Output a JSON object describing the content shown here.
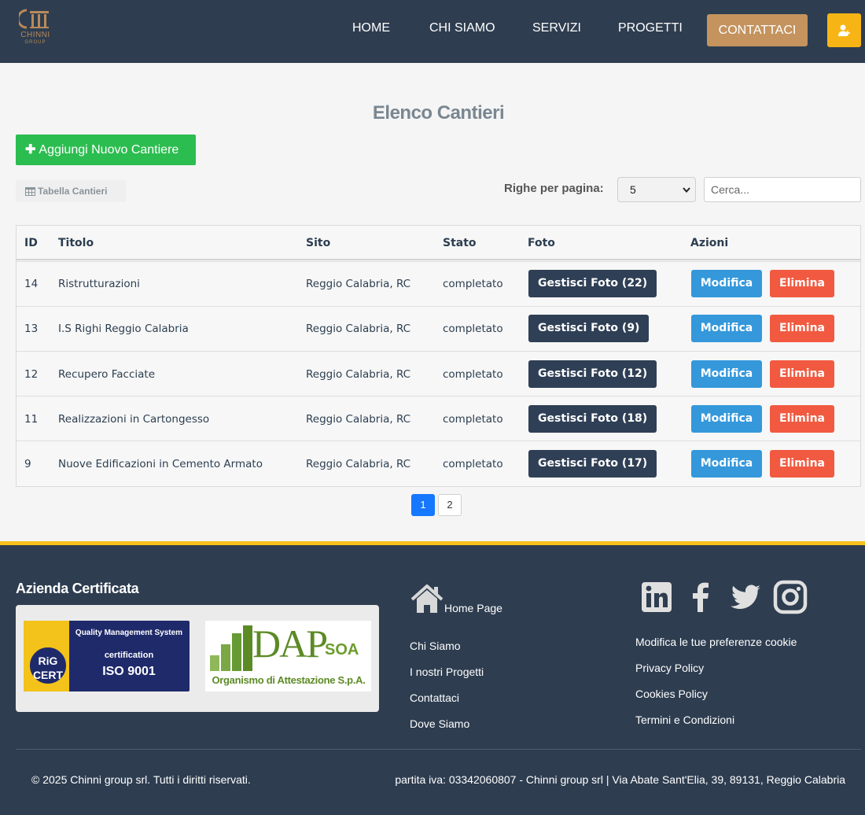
{
  "header": {
    "logo_name": "CHINNI",
    "logo_sub": "GROUP",
    "nav": [
      "HOME",
      "CHI SIAMO",
      "SERVIZI",
      "PROGETTI"
    ],
    "cta": "CONTATTACI"
  },
  "main": {
    "title": "Elenco Cantieri",
    "add_button": "Aggiungi Nuovo Cantiere",
    "table_tab": "Tabella Cantieri",
    "rows_label": "Righe per pagina:",
    "rows_value": "5",
    "search_placeholder": "Cerca...",
    "columns": [
      "ID",
      "Titolo",
      "Sito",
      "Stato",
      "Foto",
      "Azioni"
    ],
    "rows": [
      {
        "id": "14",
        "titolo": "Ristrutturazioni",
        "sito": "Reggio Calabria, RC",
        "stato": "completato",
        "foto": "Gestisci Foto (22)"
      },
      {
        "id": "13",
        "titolo": "I.S Righi Reggio Calabria",
        "sito": "Reggio Calabria, RC",
        "stato": "completato",
        "foto": "Gestisci Foto (9)"
      },
      {
        "id": "12",
        "titolo": "Recupero Facciate",
        "sito": "Reggio Calabria, RC",
        "stato": "completato",
        "foto": "Gestisci Foto (12)"
      },
      {
        "id": "11",
        "titolo": "Realizzazioni in Cartongesso",
        "sito": "Reggio Calabria, RC",
        "stato": "completato",
        "foto": "Gestisci Foto (18)"
      },
      {
        "id": "9",
        "titolo": "Nuove Edificazioni in Cemento Armato",
        "sito": "Reggio Calabria, RC",
        "stato": "completato",
        "foto": "Gestisci Foto (17)"
      }
    ],
    "modifica": "Modifica",
    "elimina": "Elimina",
    "pages": [
      "1",
      "2"
    ],
    "current_page": "1"
  },
  "footer": {
    "cert_title": "Azienda Certificata",
    "iso": {
      "brand": "RiG CERT",
      "line1": "Quality Management System",
      "line2": "certification",
      "line3": "ISO 9001"
    },
    "dap": {
      "word": "DAP",
      "soa": "SOA",
      "org": "Organismo di Attestazione S.p.A."
    },
    "home_link": "Home Page",
    "links_col1": [
      "Chi Siamo",
      "I nostri Progetti",
      "Contattaci",
      "Dove Siamo"
    ],
    "links_col2": [
      "Modifica le tue preferenze cookie",
      "Privacy Policy",
      "Cookies Policy",
      "Termini e Condizioni"
    ],
    "social": [
      "linkedin-icon",
      "facebook-icon",
      "twitter-icon",
      "instagram-icon"
    ],
    "copyright": "© 2025 Chinni group srl. Tutti i diritti riservati.",
    "piva": "partita iva: 03342060807 - Chinni group srl | Via Abate Sant'Elia, 39, 89131, Reggio Calabria"
  },
  "colors": {
    "header_bg": "#2e3d50",
    "accent_gold": "#c4935e",
    "user_button": "#f7b515",
    "add_green": "#2bbd4f",
    "foto_button": "#2f3f55",
    "modifica_blue": "#3498db",
    "elimina_red": "#f15a40",
    "footer_border": "#f7c11a"
  }
}
